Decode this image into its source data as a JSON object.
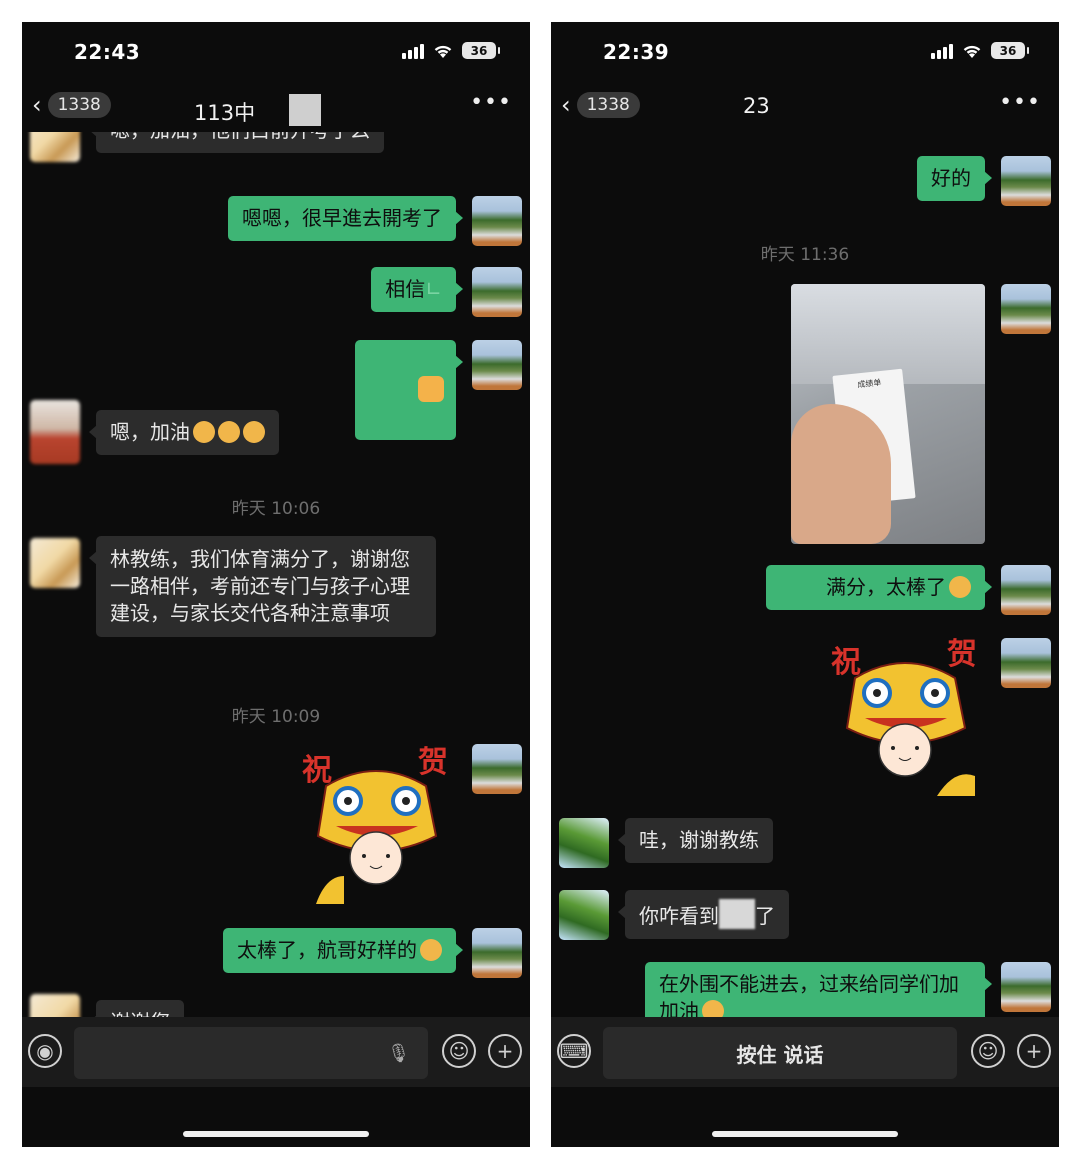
{
  "left": {
    "status": {
      "time": "22:43",
      "battery": "36"
    },
    "nav": {
      "back_count": "1338",
      "title": "113中"
    },
    "messages": {
      "partial_top": "嗯，加油，他们白前开考了么",
      "m1": "嗯嗯，很早進去開考了",
      "m2": "相信",
      "m4": "嗯，加油",
      "ts1": "昨天 10:06",
      "m5": "林教练，我们体育满分了，谢谢您一路相伴，考前还专门与孩子心理建设，与家长交代各种注意事项",
      "ts2": "昨天 10:09",
      "sticker_text1": "祝",
      "sticker_text2": "贺",
      "m7": "太棒了，航哥好样的",
      "m8": "谢谢您"
    },
    "input": {
      "placeholder": ""
    }
  },
  "right": {
    "status": {
      "time": "22:39",
      "battery": "36"
    },
    "nav": {
      "back_count": "1338",
      "title": "23"
    },
    "messages": {
      "m1": "好的",
      "ts1": "昨天 11:36",
      "photo_title": "成绩单",
      "m3": "满分，太棒了",
      "sticker_text1": "祝",
      "sticker_text2": "贺",
      "m5": "哇，谢谢教练",
      "m6a": "你咋看到",
      "m6b": "了",
      "m7": "在外围不能进去，过来给同学们加加油"
    },
    "input": {
      "hold_to_talk": "按住 说话"
    }
  },
  "colors": {
    "outgoing": "#3eb575",
    "incoming": "#2c2c2c",
    "background": "#0c0c0c"
  }
}
